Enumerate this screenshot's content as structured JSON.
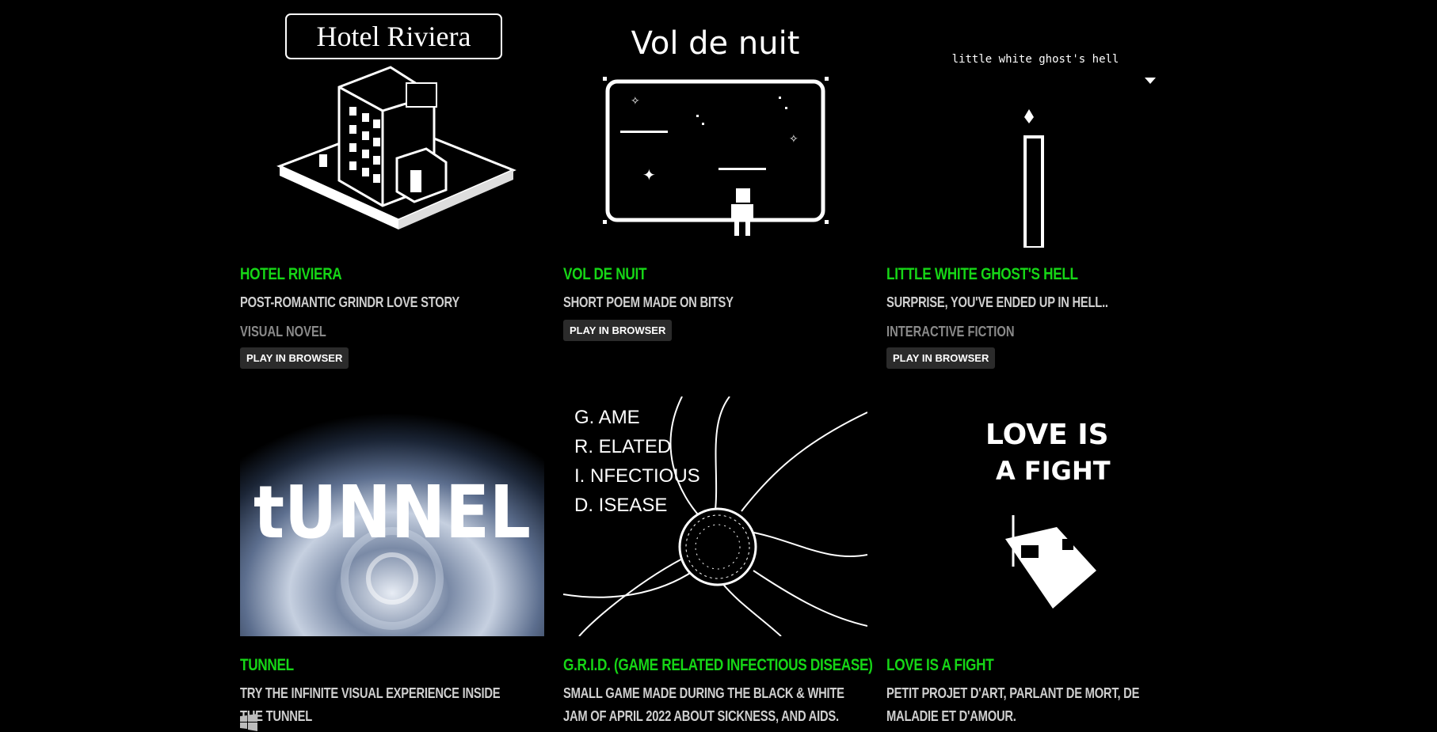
{
  "games": [
    {
      "id": "hotel-riviera",
      "thumb_text": "Hotel Riviera",
      "title": "Hotel Riviera",
      "description": "Post-romantic Grindr love story",
      "genre": "Visual Novel",
      "play_label": "Play in browser"
    },
    {
      "id": "vol-de-nuit",
      "thumb_text": "Vol de nuit",
      "title": "Vol de nuit",
      "description": "Short poem made on Bitsy",
      "genre": "",
      "play_label": "Play in browser"
    },
    {
      "id": "little-white-ghosts-hell",
      "thumb_text": "little white ghost's hell",
      "title": "Little White Ghost's Hell",
      "description": "Surprise, you've ended up in hell..",
      "genre": "Interactive Fiction",
      "play_label": "Play in browser"
    },
    {
      "id": "tunnel",
      "thumb_text": "tUNNEL",
      "title": "Tunnel",
      "description": "Try the infinite visual experience inside the tunnel",
      "platform_icon": "windows-icon"
    },
    {
      "id": "grid",
      "thumb_lines": [
        "G. AME",
        "R. ELATED",
        "I.  NFECTIOUS",
        "D. ISEASE"
      ],
      "title": "G.R.I.D. (Game Related Infectious Disease)",
      "description": "Small game made during the Black & White jam of April 2022 about sickness, and AIDS."
    },
    {
      "id": "love-is-a-fight",
      "thumb_lines": [
        "LOVE IS",
        "A FIGHT"
      ],
      "title": "Love is a fight",
      "description": "Petit projet d'art, parlant de mort, de maladie et d'amour."
    }
  ],
  "colors": {
    "background": "#000000",
    "title": "#16d616",
    "description": "#cfcfcf",
    "genre": "#8a8a8a",
    "button_bg": "#2b2b2b"
  }
}
